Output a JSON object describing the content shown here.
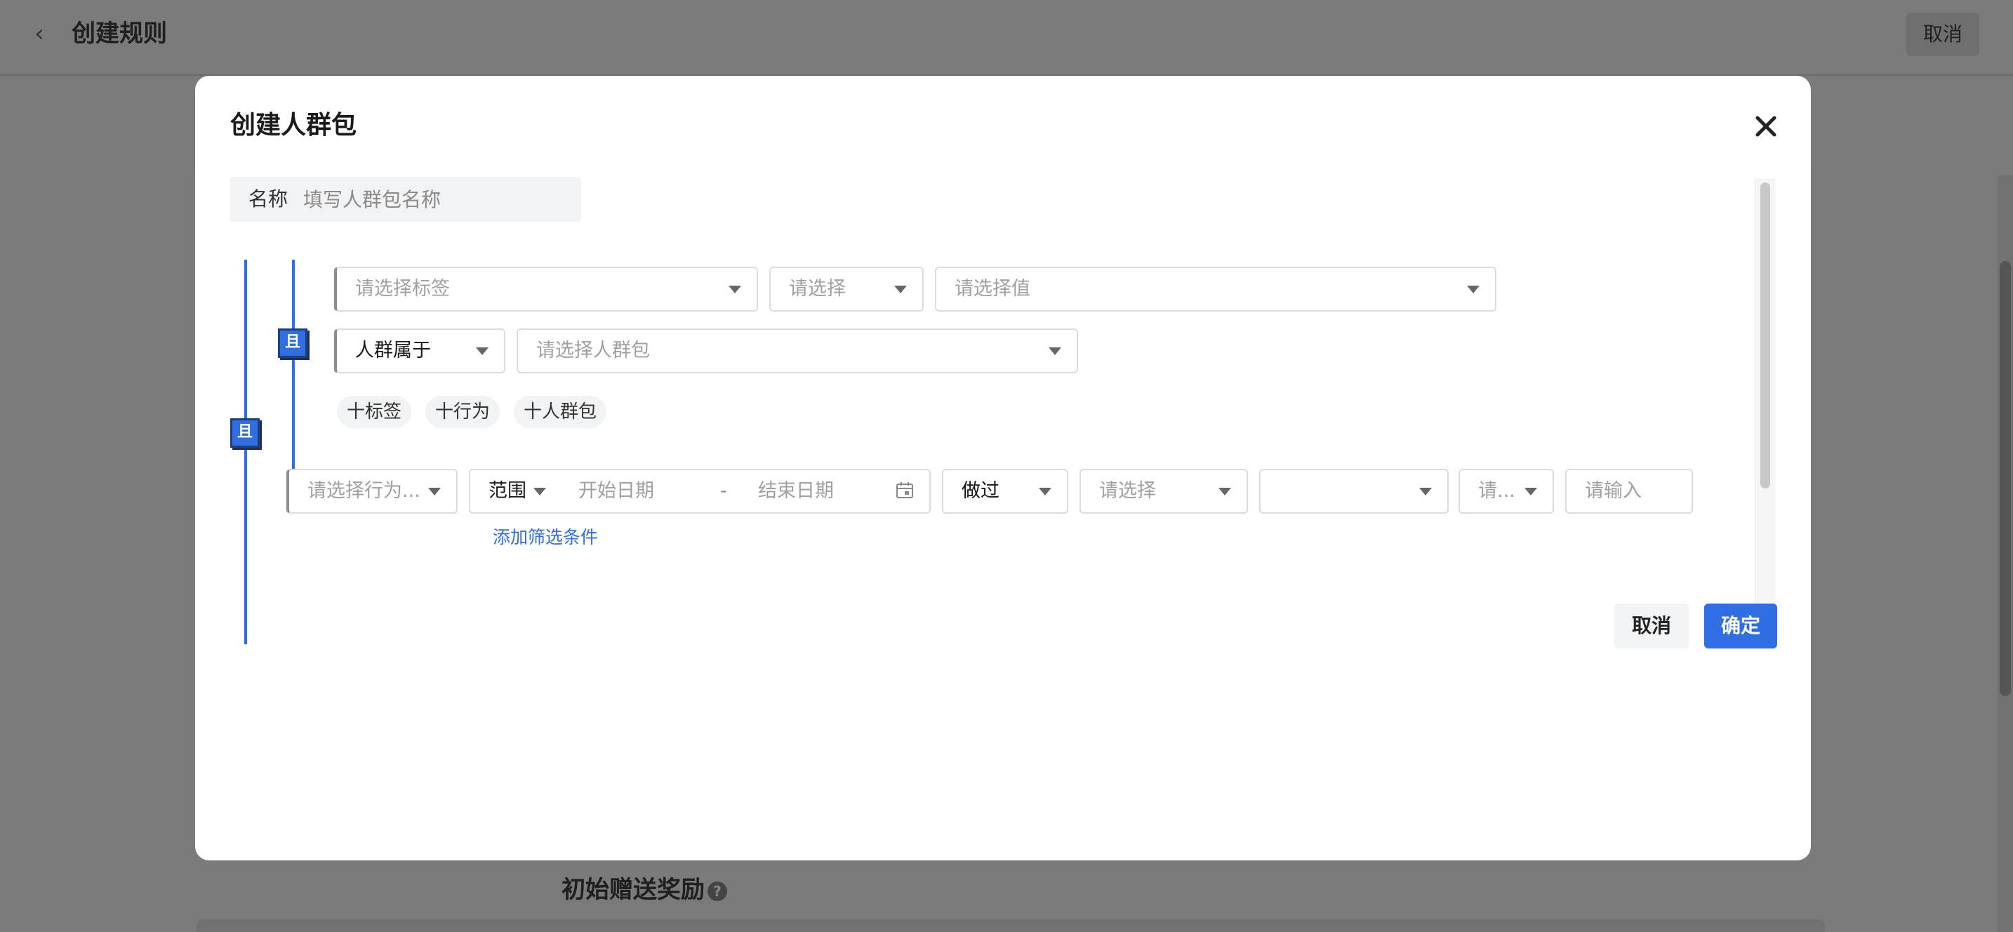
{
  "background": {
    "title": "创建规则",
    "cancel_label": "取消",
    "section_title": "初始赠送奖励"
  },
  "modal": {
    "title": "创建人群包",
    "name_label": "名称",
    "name_placeholder": "填写人群包名称",
    "logic_badge": "且",
    "rule_group": {
      "tag_select_placeholder": "请选择标签",
      "operator_placeholder": "请选择",
      "value_placeholder": "请选择值",
      "crowd_condition_value": "人群属于",
      "crowd_placeholder": "请选择人群包",
      "add_buttons": [
        "十标签",
        "十行为",
        "十人群包"
      ]
    },
    "behavior_row": {
      "behavior_placeholder": "请选择行为...",
      "range_label": "范围",
      "start_date_placeholder": "开始日期",
      "date_separator": "-",
      "end_date_placeholder": "结束日期",
      "did_value": "做过",
      "select_placeholder": "请选择",
      "empty_select": "",
      "short_select_placeholder": "请...",
      "input_placeholder": "请输入"
    },
    "add_filter_label": "添加筛选条件",
    "cancel_label": "取消",
    "confirm_label": "确定"
  },
  "icons": {
    "back": "chevron-left-icon",
    "close": "close-icon",
    "calendar": "calendar-icon",
    "help": "question-circle-icon"
  },
  "colors": {
    "primary": "#2f6fe3",
    "overlay": "#7a7a7a"
  }
}
